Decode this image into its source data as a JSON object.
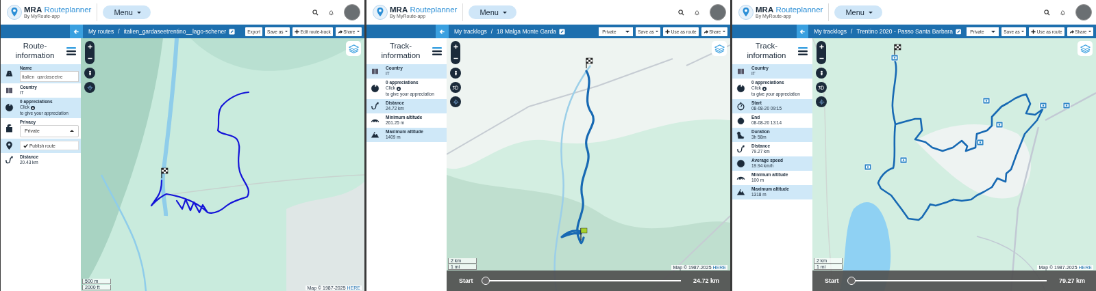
{
  "panels": [
    {
      "header": {
        "brand": "**MRA** Routeplanner",
        "byline": "By MyRoute-app",
        "menu": "Menu"
      },
      "toolbar": {
        "root": "My routes",
        "separator": "/",
        "title": "italien_gardaseetrentino__lago-schener",
        "buttons": [
          {
            "kind": "plain",
            "label": "Export"
          },
          {
            "kind": "dropdown",
            "label": "Save as"
          },
          {
            "kind": "add",
            "label": "Edit route-track"
          },
          {
            "kind": "share",
            "label": "Share"
          }
        ]
      },
      "sidebar": {
        "title": "Route-information",
        "rows": [
          {
            "kind": "name",
            "label": "Name",
            "input": "italien_gardaseetre"
          },
          {
            "kind": "country",
            "label": "Country",
            "value": "IT"
          },
          {
            "kind": "appreciation",
            "label": "0 appreciations",
            "hint_before": "Click",
            "hint_after": "to give your appreciation"
          },
          {
            "kind": "privacy",
            "label": "Privacy",
            "select": "Private"
          },
          {
            "kind": "publish",
            "button": "Publish route"
          },
          {
            "kind": "distance",
            "label": "Distance",
            "value": "20.43 km"
          }
        ]
      },
      "map": {
        "has_3d": false,
        "scale": [
          "500 m",
          "2000 ft"
        ],
        "attribution": "Map © 1987-2025",
        "attribution_link": "HERE"
      }
    },
    {
      "header": {
        "brand": "**MRA** Routeplanner",
        "byline": "By MyRoute-app",
        "menu": "Menu"
      },
      "toolbar": {
        "root": "My tracklogs",
        "separator": "/",
        "title": "18 Malga Monte Garda",
        "privacy": "Private",
        "buttons": [
          {
            "kind": "dropdown",
            "label": "Save as"
          },
          {
            "kind": "add",
            "label": "Use as route"
          },
          {
            "kind": "share",
            "label": "Share"
          }
        ]
      },
      "sidebar": {
        "title": "Track-information",
        "rows": [
          {
            "kind": "country",
            "label": "Country",
            "value": "IT"
          },
          {
            "kind": "appreciation",
            "label": "0 appreciations",
            "hint_before": "Click",
            "hint_after": "to give your appreciation"
          },
          {
            "kind": "distance",
            "label": "Distance",
            "value": "24.72 km"
          },
          {
            "kind": "minimum",
            "label": "Minimum altitude",
            "value": "261.25 m"
          },
          {
            "kind": "maximum",
            "label": "Maximum altitude",
            "value": "1409 m"
          }
        ]
      },
      "map": {
        "has_3d": true,
        "scale": [
          "2 km",
          "1 mi"
        ],
        "attribution": "Map © 1987-2025",
        "attribution_link": "HERE"
      },
      "player": {
        "start": "Start",
        "end": "24.72 km",
        "level": 0
      }
    },
    {
      "header": {
        "brand": "**MRA** Routeplanner",
        "byline": "By MyRoute-app",
        "menu": "Menu"
      },
      "toolbar": {
        "root": "My tracklogs",
        "separator": "/",
        "title": "Trentino 2020 - Passo Santa Barbara",
        "privacy": "Private",
        "buttons": [
          {
            "kind": "dropdown",
            "label": "Save as"
          },
          {
            "kind": "add",
            "label": "Use as route"
          },
          {
            "kind": "share",
            "label": "Share"
          }
        ]
      },
      "sidebar": {
        "title": "Track-information",
        "rows": [
          {
            "kind": "country",
            "label": "Country",
            "value": "IT"
          },
          {
            "kind": "appreciation",
            "label": "0 appreciations",
            "hint_before": "Click",
            "hint_after": "to give your appreciation"
          },
          {
            "kind": "start",
            "label": "Start",
            "value": "08-08-20 09:15"
          },
          {
            "kind": "end",
            "label": "End",
            "value": "08-08-20 13:14"
          },
          {
            "kind": "duration",
            "label": "Duration",
            "value": "3h 58m"
          },
          {
            "kind": "distance",
            "label": "Distance",
            "value": "79.27 km"
          },
          {
            "kind": "speed",
            "label": "Average speed",
            "value": "19.94 km/h"
          },
          {
            "kind": "minimum",
            "label": "Minimum altitude",
            "value": "100 m"
          },
          {
            "kind": "maximum",
            "label": "Maximum altitude",
            "value": "1318 m"
          }
        ]
      },
      "map": {
        "has_3d": true,
        "scale": [
          "2 km",
          "1 mi"
        ],
        "attribution": "Map © 1987-2025",
        "attribution_link": "HERE"
      },
      "player": {
        "start": "Start",
        "end": "79.27 km",
        "level": 0
      }
    }
  ]
}
